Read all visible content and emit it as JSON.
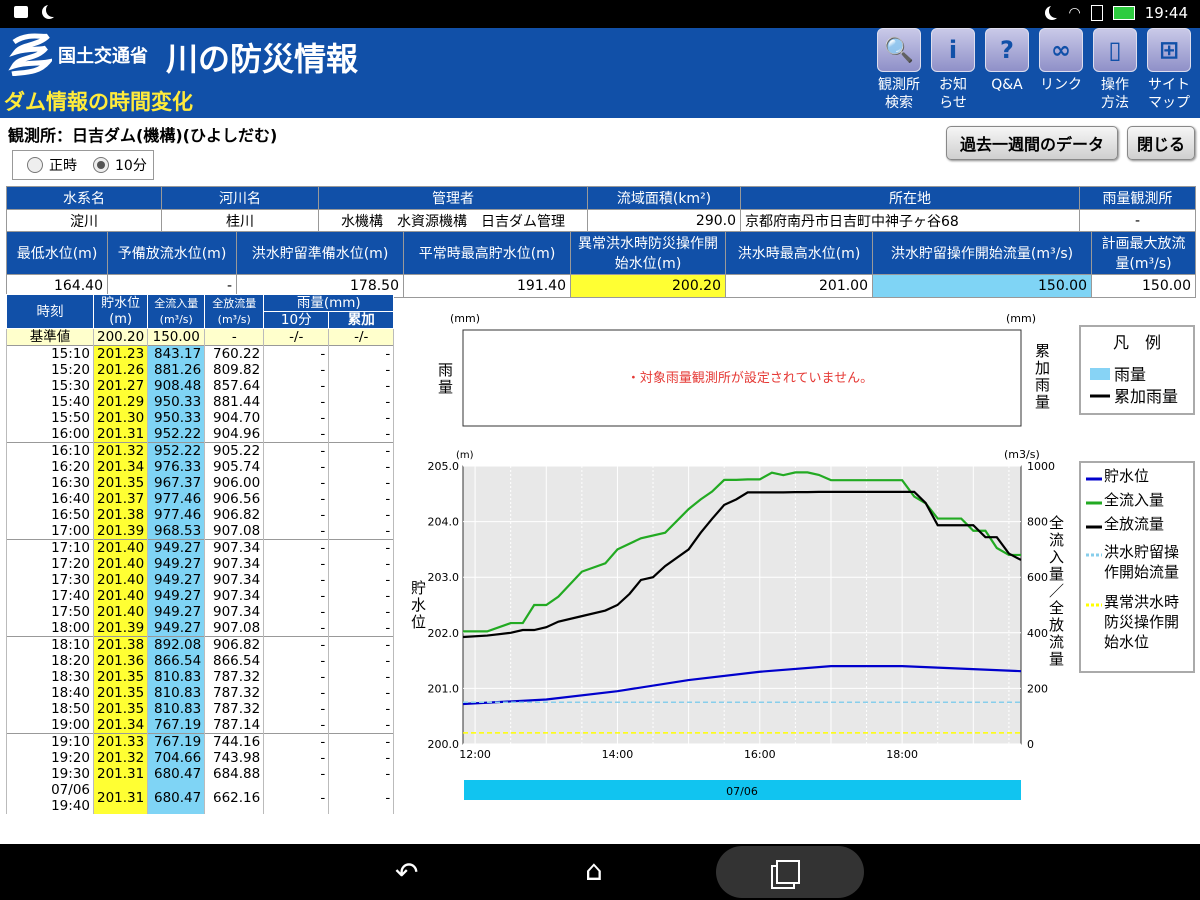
{
  "status_bar": {
    "time": "19:44"
  },
  "header": {
    "agency": "国土交通省",
    "site_title": "川の防災情報",
    "page_title": "ダム情報の時間変化",
    "nav": [
      {
        "label1": "観測所",
        "label2": "検索",
        "icon": "magnifier-icon",
        "glyph": "🔍"
      },
      {
        "label1": "お知",
        "label2": "らせ",
        "icon": "info-icon",
        "glyph": "i"
      },
      {
        "label1": "Q&A",
        "label2": "",
        "icon": "question-icon",
        "glyph": "?"
      },
      {
        "label1": "リンク",
        "label2": "",
        "icon": "link-icon",
        "glyph": "∞"
      },
      {
        "label1": "操作",
        "label2": "方法",
        "icon": "mouse-icon",
        "glyph": "▯"
      },
      {
        "label1": "サイト",
        "label2": "マップ",
        "icon": "sitemap-icon",
        "glyph": "⊞"
      }
    ]
  },
  "station": {
    "label": "観測所：日吉ダム(機構)(ひよしだむ)"
  },
  "buttons": {
    "past_week": "過去一週間のデータ",
    "close": "閉じる"
  },
  "radio": {
    "hourly": "正時",
    "ten_min": "10分",
    "selected": "10分"
  },
  "info_table": {
    "headers": [
      "水系名",
      "河川名",
      "管理者",
      "流域面積(km²)",
      "所在地",
      "雨量観測所"
    ],
    "values": [
      "淀川",
      "桂川",
      "水機構　水資源機構　日吉ダム管理",
      "290.0",
      "京都府南丹市日吉町中神子ヶ谷68",
      "-"
    ]
  },
  "level_table": {
    "headers": [
      "最低水位(m)",
      "予備放流水位(m)",
      "洪水貯留準備水位(m)",
      "平常時最高貯水位(m)",
      "異常洪水時防災操作開始水位(m)",
      "洪水時最高水位(m)",
      "洪水貯留操作開始流量(m³/s)",
      "計画最大放流量(m³/s)"
    ],
    "values": [
      "164.40",
      "-",
      "178.50",
      "191.40",
      "200.20",
      "201.00",
      "150.00",
      "150.00"
    ]
  },
  "timeseries": {
    "headers": {
      "time": "時刻",
      "level": "貯水位",
      "level_unit": "(m)",
      "inflow": "全流入量",
      "inflow_unit": "(m³/s)",
      "outflow": "全放流量",
      "outflow_unit": "(m³/s)",
      "rain": "雨量(mm)",
      "rain10": "10分",
      "rain_cum": "累加"
    },
    "base": {
      "time": "基準値",
      "level": "200.20",
      "inflow": "150.00",
      "outflow": "-",
      "rain10": "-/-",
      "rain_cum": "-/-"
    },
    "rows": [
      [
        "15:10",
        "201.23",
        "843.17",
        "760.22",
        "-",
        "-"
      ],
      [
        "15:20",
        "201.26",
        "881.26",
        "809.82",
        "-",
        "-"
      ],
      [
        "15:30",
        "201.27",
        "908.48",
        "857.64",
        "-",
        "-"
      ],
      [
        "15:40",
        "201.29",
        "950.33",
        "881.44",
        "-",
        "-"
      ],
      [
        "15:50",
        "201.30",
        "950.33",
        "904.70",
        "-",
        "-"
      ],
      [
        "16:00",
        "201.31",
        "952.22",
        "904.96",
        "-",
        "-"
      ],
      [
        "16:10",
        "201.32",
        "952.22",
        "905.22",
        "-",
        "-"
      ],
      [
        "16:20",
        "201.34",
        "976.33",
        "905.74",
        "-",
        "-"
      ],
      [
        "16:30",
        "201.35",
        "967.37",
        "906.00",
        "-",
        "-"
      ],
      [
        "16:40",
        "201.37",
        "977.46",
        "906.56",
        "-",
        "-"
      ],
      [
        "16:50",
        "201.38",
        "977.46",
        "906.82",
        "-",
        "-"
      ],
      [
        "17:00",
        "201.39",
        "968.53",
        "907.08",
        "-",
        "-"
      ],
      [
        "17:10",
        "201.40",
        "949.27",
        "907.34",
        "-",
        "-"
      ],
      [
        "17:20",
        "201.40",
        "949.27",
        "907.34",
        "-",
        "-"
      ],
      [
        "17:30",
        "201.40",
        "949.27",
        "907.34",
        "-",
        "-"
      ],
      [
        "17:40",
        "201.40",
        "949.27",
        "907.34",
        "-",
        "-"
      ],
      [
        "17:50",
        "201.40",
        "949.27",
        "907.34",
        "-",
        "-"
      ],
      [
        "18:00",
        "201.39",
        "949.27",
        "907.08",
        "-",
        "-"
      ],
      [
        "18:10",
        "201.38",
        "892.08",
        "906.82",
        "-",
        "-"
      ],
      [
        "18:20",
        "201.36",
        "866.54",
        "866.54",
        "-",
        "-"
      ],
      [
        "18:30",
        "201.35",
        "810.83",
        "787.32",
        "-",
        "-"
      ],
      [
        "18:40",
        "201.35",
        "810.83",
        "787.32",
        "-",
        "-"
      ],
      [
        "18:50",
        "201.35",
        "810.83",
        "787.32",
        "-",
        "-"
      ],
      [
        "19:00",
        "201.34",
        "767.19",
        "787.14",
        "-",
        "-"
      ],
      [
        "19:10",
        "201.33",
        "767.19",
        "744.16",
        "-",
        "-"
      ],
      [
        "19:20",
        "201.32",
        "704.66",
        "743.98",
        "-",
        "-"
      ],
      [
        "19:30",
        "201.31",
        "680.47",
        "684.88",
        "-",
        "-"
      ],
      [
        "07/06 19:40",
        "201.31",
        "680.47",
        "662.16",
        "-",
        "-"
      ]
    ]
  },
  "rain_chart": {
    "unit_left": "(mm)",
    "unit_right": "(mm)",
    "ylabel_left": "雨量",
    "ylabel_right": "累加雨量",
    "message": "・対象雨量観測所が設定されていません。"
  },
  "legend_rain": {
    "title": "凡　例",
    "items": [
      {
        "label": "雨量",
        "color": "#87d3f5"
      },
      {
        "label": "累加雨量",
        "color": "#000000"
      }
    ]
  },
  "legend_main": {
    "items": [
      {
        "label": "貯水位",
        "color": "#0000cc"
      },
      {
        "label": "全流入量",
        "color": "#22aa22"
      },
      {
        "label": "全放流量",
        "color": "#000000"
      },
      {
        "label": "洪水貯留操作開始流量",
        "color": "#87ceeb"
      },
      {
        "label": "異常洪水時防災操作開始水位",
        "color": "#ffff00"
      }
    ]
  },
  "date_bar": "07/06",
  "chart_data": {
    "type": "line",
    "x_ticks": [
      "12:00",
      "14:00",
      "16:00",
      "18:00"
    ],
    "xlabel": "",
    "ylabel": "貯水位",
    "yunit": "(m)",
    "y2label": "全流入量／全放流量",
    "y2unit": "(m3/s)",
    "ylim": [
      200.0,
      205.0
    ],
    "y2lim": [
      0,
      1000
    ],
    "yticks": [
      "200.0",
      "201.0",
      "202.0",
      "203.0",
      "204.0",
      "205.0"
    ],
    "y2ticks": [
      "0",
      "200",
      "400",
      "600",
      "800",
      "1000"
    ],
    "grid": true,
    "series": [
      {
        "name": "貯水位",
        "axis": "left",
        "color": "#0000cc",
        "x": [
          11.83,
          13,
          14,
          15,
          16,
          17,
          18,
          19.67
        ],
        "y": [
          200.72,
          200.8,
          200.95,
          201.15,
          201.3,
          201.4,
          201.4,
          201.31
        ]
      },
      {
        "name": "全流入量",
        "axis": "right",
        "color": "#22aa22",
        "x": [
          11.83,
          12.17,
          12.5,
          12.67,
          12.83,
          13,
          13.17,
          13.5,
          13.83,
          14,
          14.33,
          14.67,
          15,
          15.17,
          15.33,
          15.5,
          15.67,
          15.83,
          16,
          16.17,
          16.33,
          16.5,
          16.67,
          16.83,
          17,
          17.17,
          17.33,
          17.5,
          17.67,
          17.83,
          18,
          18.17,
          18.33,
          18.5,
          18.67,
          18.83,
          19,
          19.17,
          19.33,
          19.5,
          19.67
        ],
        "y": [
          405,
          405,
          435,
          435,
          500,
          500,
          530,
          620,
          650,
          700,
          740,
          760,
          845,
          880,
          908,
          950,
          950,
          952,
          952,
          976,
          967,
          977,
          977,
          968,
          949,
          949,
          949,
          949,
          949,
          949,
          949,
          890,
          866,
          811,
          811,
          811,
          767,
          767,
          705,
          680,
          680
        ]
      },
      {
        "name": "全放流量",
        "axis": "right",
        "color": "#000000",
        "x": [
          11.83,
          12.17,
          12.5,
          12.67,
          12.83,
          13,
          13.17,
          13.5,
          13.83,
          14,
          14.17,
          14.33,
          14.5,
          14.67,
          15,
          15.17,
          15.33,
          15.5,
          15.67,
          15.83,
          16,
          16.17,
          16.33,
          16.5,
          16.67,
          16.83,
          17,
          17.17,
          17.33,
          17.5,
          17.67,
          17.83,
          18,
          18.17,
          18.33,
          18.5,
          18.67,
          18.83,
          19,
          19.17,
          19.33,
          19.5,
          19.67
        ],
        "y": [
          385,
          390,
          400,
          410,
          410,
          420,
          440,
          460,
          480,
          500,
          540,
          590,
          600,
          640,
          700,
          760,
          810,
          860,
          880,
          905,
          905,
          905,
          905,
          906,
          906,
          907,
          907,
          907,
          907,
          907,
          907,
          907,
          907,
          907,
          867,
          787,
          787,
          787,
          787,
          744,
          744,
          685,
          662
        ]
      },
      {
        "name": "洪水貯留操作開始流量",
        "axis": "right",
        "color": "#87ceeb",
        "dashed": true,
        "x": [
          11.83,
          19.67
        ],
        "y": [
          150,
          150
        ]
      },
      {
        "name": "異常洪水時防災操作開始水位",
        "axis": "left",
        "color": "#ffff00",
        "dashed": true,
        "x": [
          11.83,
          19.67
        ],
        "y": [
          200.2,
          200.2
        ]
      }
    ]
  },
  "navbar": {
    "back": "back-icon",
    "home": "home-icon",
    "recents": "recents-icon"
  }
}
